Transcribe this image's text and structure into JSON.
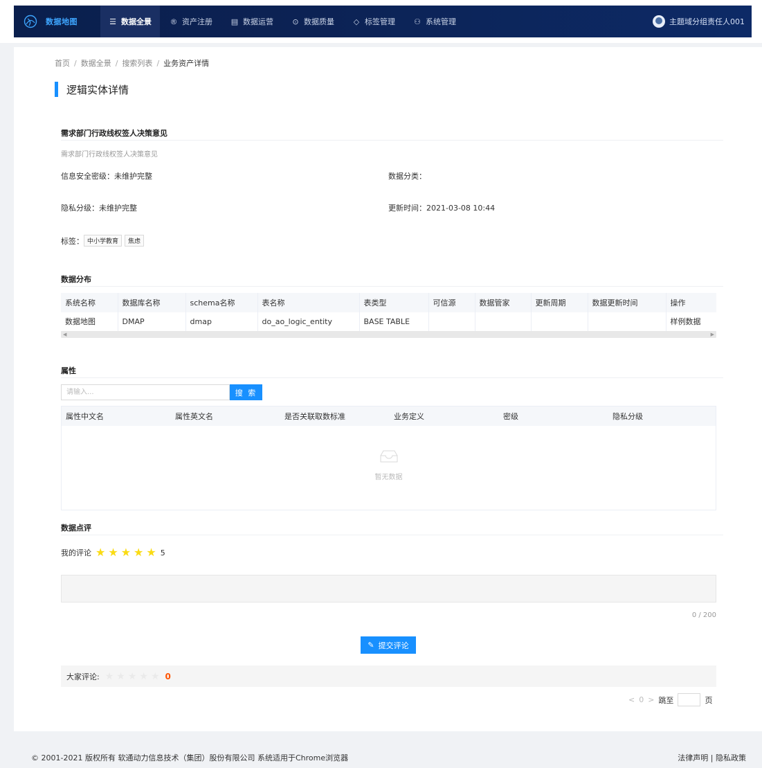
{
  "nav": {
    "logo_text": "数据地图",
    "items": [
      {
        "label": "数据全景",
        "icon": "list-icon"
      },
      {
        "label": "资产注册",
        "icon": "registered-icon"
      },
      {
        "label": "数据运营",
        "icon": "document-icon"
      },
      {
        "label": "数据质量",
        "icon": "check-circle-icon"
      },
      {
        "label": "标签管理",
        "icon": "tag-icon"
      },
      {
        "label": "系统管理",
        "icon": "org-icon"
      }
    ],
    "user": "主题域分组责任人001"
  },
  "breadcrumb": {
    "items": [
      "首页",
      "数据全景",
      "搜索列表"
    ],
    "current": "业务资产详情",
    "sep": "/"
  },
  "page_title": "逻辑实体详情",
  "entity": {
    "name": "需求部门行政线权签人决策意见",
    "description": "需求部门行政线权签人决策意见",
    "security_level": "信息安全密级：未维护完整",
    "data_category": "数据分类：",
    "privacy_level": "隐私分级：未维护完整",
    "update_time": "更新时间：2021-03-08 10:44",
    "tags_label": "标签：",
    "tags": [
      "中小学教育",
      "焦虑"
    ]
  },
  "distribution": {
    "title": "数据分布",
    "columns": [
      "系统名称",
      "数据库名称",
      "schema名称",
      "表名称",
      "表类型",
      "可信源",
      "数据管家",
      "更新周期",
      "数据更新时间",
      "操作"
    ],
    "rows": [
      [
        "数据地图",
        "DMAP",
        "dmap",
        "do_ao_logic_entity",
        "BASE TABLE",
        "",
        "",
        "",
        "",
        "样例数据"
      ]
    ]
  },
  "attributes": {
    "title": "属性",
    "search_placeholder": "请输入...",
    "search_button": "搜 索",
    "columns": [
      "属性中文名",
      "属性英文名",
      "是否关联取数标准",
      "业务定义",
      "密级",
      "隐私分级"
    ],
    "empty_text": "暂无数据"
  },
  "review": {
    "title": "数据点评",
    "my_label": "我的评论",
    "my_stars": 5,
    "my_score": "5",
    "counter": "0 / 200",
    "submit": "提交评论",
    "all_label": "大家评论:",
    "all_stars": 0,
    "all_score": "0"
  },
  "pager": {
    "prev": "<",
    "page": "0",
    "next": ">",
    "goto": "跳至",
    "unit": "页"
  },
  "footer": {
    "copyright": "© 2001-2021 版权所有 软通动力信息技术（集团）股份有限公司 系统适用于Chrome浏览器",
    "links": "法律声明 | 隐私政策"
  },
  "colors": {
    "accent": "#1890ff",
    "nav_bg": "#0c2254",
    "star": "#fadb14",
    "score": "#ff5500"
  }
}
